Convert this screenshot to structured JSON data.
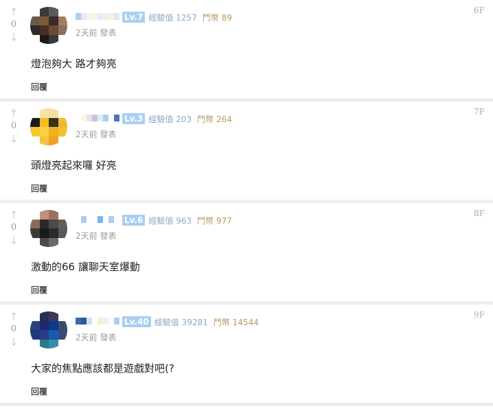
{
  "comments": [
    {
      "floor": "6F",
      "votes": "0",
      "level": "Lv.7",
      "exp": "經驗值 1257",
      "gp": "鬥幣 89",
      "time": "2天前 發表",
      "content": "燈泡夠大 路才夠亮",
      "reply": "回覆",
      "avatar_colors": [
        "#ffffff",
        "#3a3a3a",
        "#5b5b5b",
        "#ffffff",
        "#6a5a4a",
        "#7b5a3a",
        "#3a2a2a",
        "#a08060",
        "#2a2a2a",
        "#4a3020",
        "#6a4a30",
        "#8a7060",
        "#ffffff",
        "#1a1a1a",
        "#3a3a3a",
        "#ffffff"
      ],
      "name_colors": [
        "#a8cff2",
        "#e0ecf8",
        "#f2f2f2",
        "#f5f5e6",
        "#efe8f4",
        "#e8f3e8",
        "#f9f4d8",
        "#d8e8f8"
      ]
    },
    {
      "floor": "7F",
      "votes": "0",
      "level": "Lv.3",
      "exp": "經驗值 203",
      "gp": "鬥幣 264",
      "time": "2天前 發表",
      "content": "頭燈亮起來囉 好亮",
      "reply": "回覆",
      "avatar_colors": [
        "#ffffff",
        "#f5e2a8",
        "#f3dfa0",
        "#ffffff",
        "#1a1a1a",
        "#f0c020",
        "#3a3020",
        "#f2b830",
        "#f6c828",
        "#f8d040",
        "#f0b020",
        "#f4c030",
        "#ffffff",
        "#f8c040",
        "#f0a020",
        "#ffffff"
      ],
      "name_colors": [
        "#ffffff",
        "#fbf8e8",
        "#e8dff0",
        "#cfc0e0",
        "#e0ecf8",
        "#a8cff2",
        "#ffffff",
        "#4a74c8"
      ]
    },
    {
      "floor": "8F",
      "votes": "0",
      "level": "Lv.6",
      "exp": "經驗值 963",
      "gp": "鬥幣 977",
      "time": "2天前 發表",
      "content": "激動的66 讓聊天室爆動",
      "reply": "回覆",
      "avatar_colors": [
        "#ffffff",
        "#c09080",
        "#a07060",
        "#ffffff",
        "#8a6a5a",
        "#2a2a2a",
        "#4a4a4a",
        "#6a5a50",
        "#3a3a3a",
        "#1a1a1a",
        "#2a2a2a",
        "#5a5a5a",
        "#ffffff",
        "#4a4a4a",
        "#6a6a6a",
        "#ffffff"
      ],
      "name_colors": [
        "#ffffff",
        "#a8cff2",
        "#ffffff",
        "#ffffff",
        "#78b4ee",
        "#ffffff",
        "#a8cff2",
        "#ffffff"
      ]
    },
    {
      "floor": "9F",
      "votes": "0",
      "level": "Lv.40",
      "exp": "經驗值 39281",
      "gp": "鬥幣 14544",
      "time": "2天前 發表",
      "content": "大家的焦點應該都是遊戲對吧(?",
      "reply": "回覆",
      "avatar_colors": [
        "#ffffff",
        "#2a3050",
        "#3a3a5a",
        "#ffffff",
        "#2a4080",
        "#1a2a6a",
        "#0a3a8a",
        "#3a4a6a",
        "#1a3a7a",
        "#2a3a8a",
        "#1a5aaa",
        "#3a4a7a",
        "#ffffff",
        "#2a7a8a",
        "#3a8aaa",
        "#ffffff"
      ],
      "name_colors": [
        "#3a6aa8",
        "#2a5a98",
        "#cfe2f4",
        "#ffffff",
        "#f8f0c8",
        "#e8f2f8",
        "#ffffff",
        "#a8cff2"
      ]
    }
  ]
}
